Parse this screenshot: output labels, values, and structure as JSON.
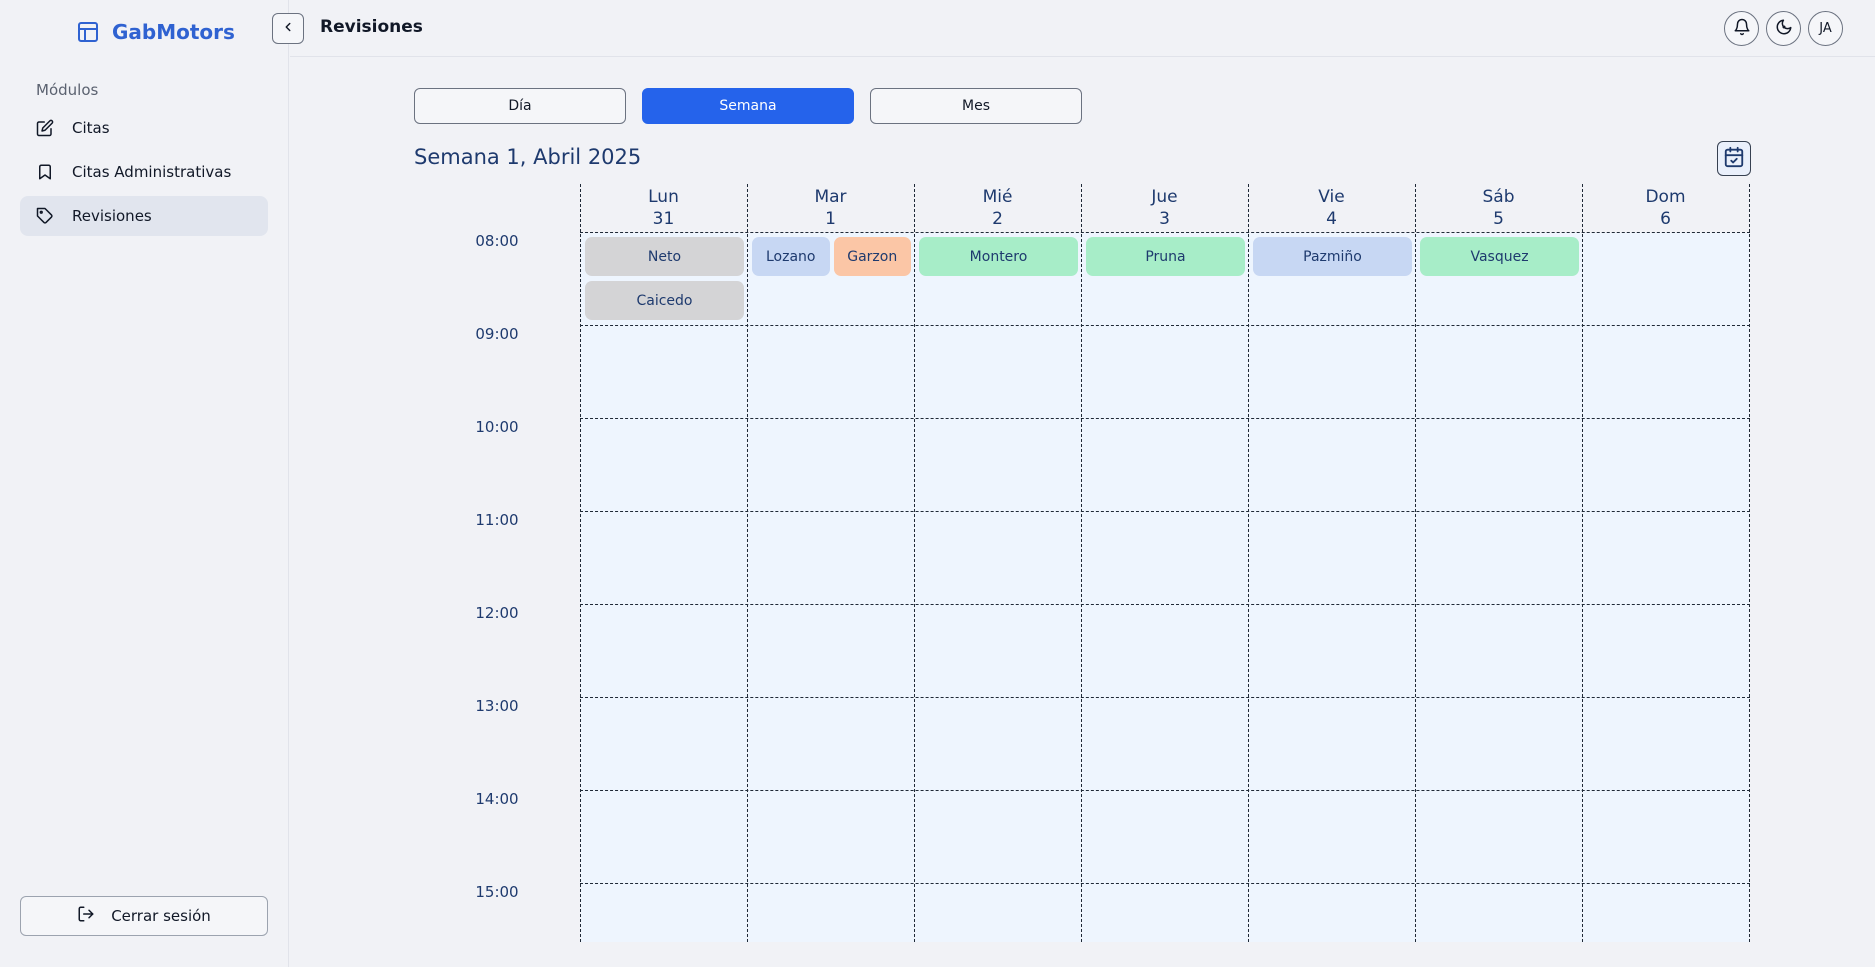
{
  "app": {
    "brand": "GabMotors"
  },
  "sidebar": {
    "section_label": "Módulos",
    "items": [
      {
        "label": "Citas",
        "icon": "edit-icon",
        "active": false
      },
      {
        "label": "Citas Administrativas",
        "icon": "bookmark-icon",
        "active": false
      },
      {
        "label": "Revisiones",
        "icon": "tag-icon",
        "active": true
      }
    ],
    "logout_label": "Cerrar sesión"
  },
  "header": {
    "title": "Revisiones",
    "avatar_initials": "JA",
    "actions": [
      "bell-icon",
      "theme-toggle-icon",
      "avatar"
    ]
  },
  "view_tabs": [
    {
      "label": "Día",
      "active": false
    },
    {
      "label": "Semana",
      "active": true
    },
    {
      "label": "Mes",
      "active": false
    }
  ],
  "calendar": {
    "week_title": "Semana 1, Abril 2025",
    "days": [
      {
        "name": "Lun",
        "num": "31"
      },
      {
        "name": "Mar",
        "num": "1"
      },
      {
        "name": "Mié",
        "num": "2"
      },
      {
        "name": "Jue",
        "num": "3"
      },
      {
        "name": "Vie",
        "num": "4"
      },
      {
        "name": "Sáb",
        "num": "5"
      },
      {
        "name": "Dom",
        "num": "6"
      }
    ],
    "hours": [
      "08:00",
      "09:00",
      "10:00",
      "11:00",
      "12:00",
      "13:00",
      "14:00",
      "15:00"
    ],
    "events": [
      {
        "label": "Neto",
        "day": 0,
        "hour": "08:00",
        "stack": 0,
        "color": "#d4d4d6"
      },
      {
        "label": "Caicedo",
        "day": 0,
        "hour": "08:00",
        "stack": 1,
        "color": "#d4d4d6"
      },
      {
        "label": "Lozano",
        "day": 1,
        "hour": "08:00",
        "stack": 0,
        "color": "#c7d7f3"
      },
      {
        "label": "Garzon",
        "day": 1,
        "hour": "08:00",
        "stack": 0,
        "color": "#fbc6a6"
      },
      {
        "label": "Montero",
        "day": 2,
        "hour": "08:00",
        "stack": 0,
        "color": "#a7edc8"
      },
      {
        "label": "Pruna",
        "day": 3,
        "hour": "08:00",
        "stack": 0,
        "color": "#a7edc8"
      },
      {
        "label": "Pazmiño",
        "day": 4,
        "hour": "08:00",
        "stack": 0,
        "color": "#c7d7f3"
      },
      {
        "label": "Vasquez",
        "day": 5,
        "hour": "08:00",
        "stack": 0,
        "color": "#a7edc8"
      }
    ]
  },
  "colors": {
    "accent": "#2563eb",
    "brand": "#2f62d1",
    "cell_bg": "#eef5fe",
    "heading": "#1e3a6e"
  }
}
